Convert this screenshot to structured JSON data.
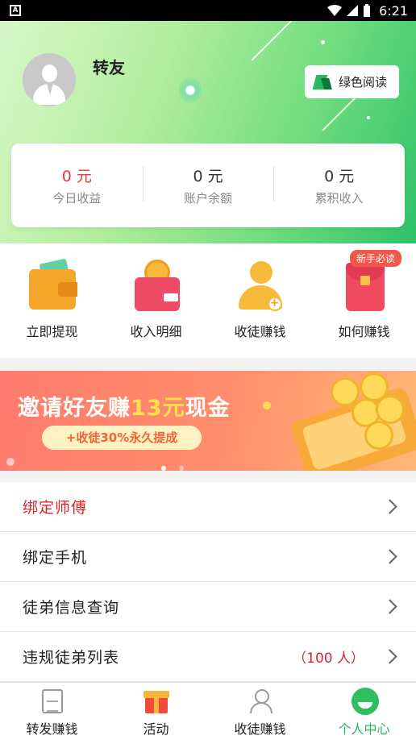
{
  "status_bar": {
    "time": "6:21"
  },
  "profile": {
    "username": "转友",
    "brand_button": "绿色阅读"
  },
  "stats": [
    {
      "value": "0 元",
      "label": "今日收益"
    },
    {
      "value": "0 元",
      "label": "账户余额"
    },
    {
      "value": "0 元",
      "label": "累积收入"
    }
  ],
  "actions": [
    {
      "label": "立即提现",
      "icon": "wallet-icon"
    },
    {
      "label": "收入明细",
      "icon": "money-purse-icon"
    },
    {
      "label": "收徒赚钱",
      "icon": "add-person-icon"
    },
    {
      "label": "如何赚钱",
      "icon": "red-envelope-icon"
    }
  ],
  "new_user_badge": "新手必读",
  "banner": {
    "title_prefix": "邀请好友赚",
    "title_amount": "13元",
    "title_suffix": "现金",
    "pill": "+收徒30%永久提成"
  },
  "menu": [
    {
      "label": "绑定师傅",
      "extra": ""
    },
    {
      "label": "绑定手机",
      "extra": ""
    },
    {
      "label": "徒弟信息查询",
      "extra": ""
    },
    {
      "label": "违规徒弟列表",
      "extra": "（100 人）"
    }
  ],
  "tabs": [
    {
      "label": "转发赚钱",
      "icon": "news-icon"
    },
    {
      "label": "活动",
      "icon": "gift-icon"
    },
    {
      "label": "收徒赚钱",
      "icon": "people-icon"
    },
    {
      "label": "个人中心",
      "icon": "profile-icon"
    }
  ],
  "colors": {
    "accent_green": "#27b860",
    "alert_red": "#d9262c"
  }
}
